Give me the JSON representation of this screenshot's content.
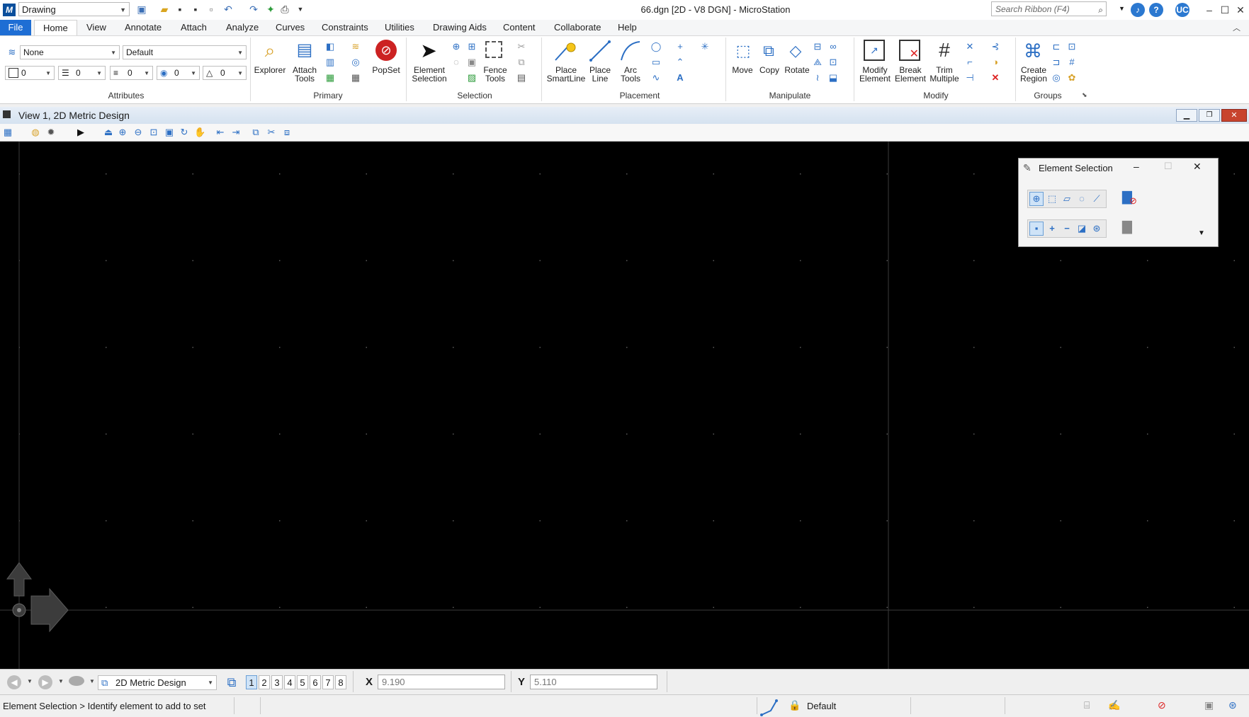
{
  "titlebar": {
    "workflow": "Drawing",
    "title": "66.dgn [2D - V8 DGN] - MicroStation",
    "search_placeholder": "Search Ribbon (F4)",
    "user_initials": "UC"
  },
  "tabs": [
    "File",
    "Home",
    "View",
    "Annotate",
    "Attach",
    "Analyze",
    "Curves",
    "Constraints",
    "Utilities",
    "Drawing Aids",
    "Content",
    "Collaborate",
    "Help"
  ],
  "attributes": {
    "level": "None",
    "style_combo": "Default",
    "color": "0",
    "weight": "0",
    "line_style": "0",
    "transparency": "0",
    "priority": "0",
    "group_label": "Attributes"
  },
  "primary": {
    "explorer": "Explorer",
    "attach_tools_1": "Attach",
    "attach_tools_2": "Tools",
    "popset": "PopSet",
    "group_label": "Primary"
  },
  "selection": {
    "element_selection_1": "Element",
    "element_selection_2": "Selection",
    "fence_tools_1": "Fence",
    "fence_tools_2": "Tools",
    "group_label": "Selection"
  },
  "placement": {
    "place_smartline_1": "Place",
    "place_smartline_2": "SmartLine",
    "place_line_1": "Place",
    "place_line_2": "Line",
    "arc_tools_1": "Arc",
    "arc_tools_2": "Tools",
    "group_label": "Placement"
  },
  "manipulate": {
    "move": "Move",
    "copy": "Copy",
    "rotate": "Rotate",
    "group_label": "Manipulate"
  },
  "modify": {
    "modify_element_1": "Modify",
    "modify_element_2": "Element",
    "break_element_1": "Break",
    "break_element_2": "Element",
    "trim_multiple_1": "Trim",
    "trim_multiple_2": "Multiple",
    "group_label": "Modify"
  },
  "groups": {
    "create_region_1": "Create",
    "create_region_2": "Region",
    "group_label": "Groups"
  },
  "view": {
    "title": "View 1, 2D Metric Design"
  },
  "element_selection_dialog": {
    "title": "Element Selection"
  },
  "bottom": {
    "model": "2D Metric Design",
    "view_numbers": [
      "1",
      "2",
      "3",
      "4",
      "5",
      "6",
      "7",
      "8"
    ],
    "x_label": "X",
    "x_value": "9.190",
    "y_label": "Y",
    "y_value": "5.110"
  },
  "status": {
    "prompt": "Element Selection > Identify element to add to set",
    "active_level": "Default"
  },
  "colors": {
    "accent": "#1e6ed4",
    "canvas": "#000000",
    "grid_dot": "#5a5a5a",
    "crosshair": "#3a3a3a"
  }
}
